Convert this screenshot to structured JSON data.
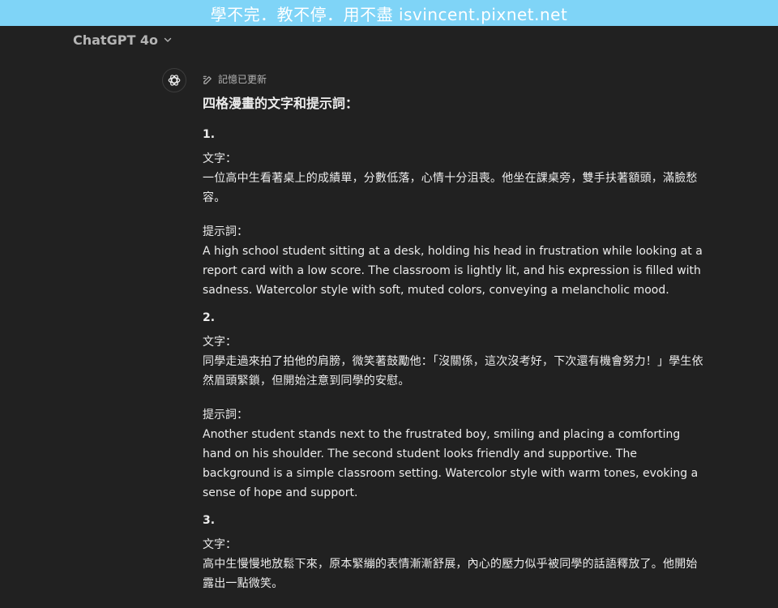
{
  "banner": {
    "text": "學不完．教不停．用不盡  isvincent.pixnet.net"
  },
  "header": {
    "model": "ChatGPT 4o"
  },
  "message": {
    "memory_note": "記憶已更新",
    "heading": "四格漫畫的文字和提示詞：",
    "panels": [
      {
        "number": "1.",
        "text_label": "文字：",
        "text": "一位高中生看著桌上的成績單，分數低落，心情十分沮喪。他坐在課桌旁，雙手扶著額頭，滿臉愁容。",
        "prompt_label": "提示詞：",
        "prompt": "A high school student sitting at a desk, holding his head in frustration while looking at a report card with a low score. The classroom is lightly lit, and his expression is filled with sadness. Watercolor style with soft, muted colors, conveying a melancholic mood."
      },
      {
        "number": "2.",
        "text_label": "文字：",
        "text": "同學走過來拍了拍他的肩膀，微笑著鼓勵他：「沒關係，這次沒考好，下次還有機會努力！」學生依然眉頭緊鎖，但開始注意到同學的安慰。",
        "prompt_label": "提示詞：",
        "prompt": "Another student stands next to the frustrated boy, smiling and placing a comforting hand on his shoulder. The second student looks friendly and supportive. The background is a simple classroom setting. Watercolor style with warm tones, evoking a sense of hope and support."
      },
      {
        "number": "3.",
        "text_label": "文字：",
        "text": "高中生慢慢地放鬆下來，原本緊繃的表情漸漸舒展，內心的壓力似乎被同學的話語釋放了。他開始露出一點微笑。"
      }
    ]
  }
}
